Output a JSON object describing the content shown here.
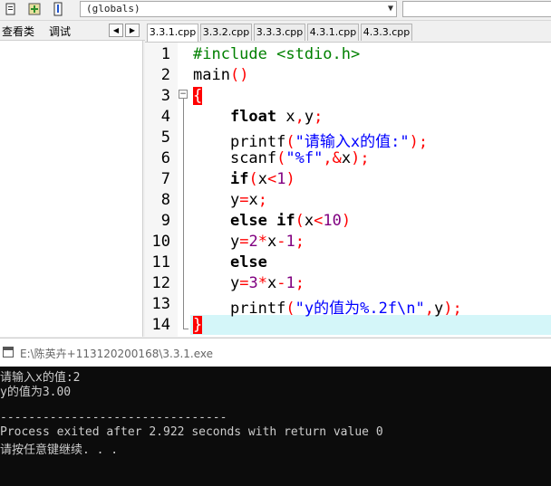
{
  "toolbar": {
    "scope_select": "(globals)",
    "icons": [
      "compile-icon",
      "add-icon",
      "info-icon"
    ]
  },
  "left_panel": {
    "tabs": [
      "查看类",
      "调试"
    ],
    "nav_prev": "◀",
    "nav_next": "▶"
  },
  "editor": {
    "tabs": [
      "3.3.1.cpp",
      "3.3.2.cpp",
      "3.3.3.cpp",
      "4.3.1.cpp",
      "4.3.3.cpp"
    ],
    "active_tab": "3.3.1.cpp",
    "line_numbers": [
      "1",
      "2",
      "3",
      "4",
      "5",
      "6",
      "7",
      "8",
      "9",
      "10",
      "11",
      "12",
      "13",
      "14"
    ],
    "code": {
      "l1_dir": "#include <stdio.h>",
      "l2_name": "main",
      "l2_paren": "()",
      "l3_brace": "{",
      "l4_kw": "float",
      "l4_a": " x",
      "l4_b": ",",
      "l4_c": "y",
      "l4_d": ";",
      "l5_fn": "printf",
      "l5_p": "(",
      "l5_str": "\"请输入x的值:\"",
      "l5_end": ");",
      "l6_fn": "scanf",
      "l6_p": "(",
      "l6_str": "\"%f\"",
      "l6_comma": ",&",
      "l6_x": "x",
      "l6_end": ");",
      "l7_kw": "if",
      "l7_p": "(",
      "l7_x": "x",
      "l7_op": "<",
      "l7_n": "1",
      "l7_end": ")",
      "l8_y": "y",
      "l8_op": "=",
      "l8_x": "x",
      "l8_end": ";",
      "l9_kw": "else if",
      "l9_p": "(",
      "l9_x": "x",
      "l9_op": "<",
      "l9_n": "10",
      "l9_end": ")",
      "l10_y": "y",
      "l10_op": "=",
      "l10_n": "2",
      "l10_mul": "*",
      "l10_x": "x",
      "l10_minus": "-",
      "l10_one": "1",
      "l10_end": ";",
      "l11_kw": "else",
      "l12_y": "y",
      "l12_op": "=",
      "l12_n": "3",
      "l12_mul": "*",
      "l12_x": "x",
      "l12_minus": "-",
      "l12_one": "1",
      "l12_end": ";",
      "l13_fn": "printf",
      "l13_p": "(",
      "l13_str": "\"y的值为%.2f\\n\"",
      "l13_comma": ",",
      "l13_y": "y",
      "l13_end": ");",
      "l14_brace": "}"
    }
  },
  "console": {
    "title": "E:\\陈英卉+113120200168\\3.3.1.exe",
    "lines": [
      "请输入x的值:2",
      "y的值为3.00",
      "",
      "--------------------------------",
      "Process exited after 2.922 seconds with return value 0",
      "请按任意键继续. . ."
    ]
  },
  "colors": {
    "keyword": "#000000",
    "preprocessor": "#008000",
    "symbol": "#ff0000",
    "string": "#0000ff",
    "number": "#800080",
    "current_line": "#d4f6f9",
    "console_bg": "#0c0c0c"
  }
}
